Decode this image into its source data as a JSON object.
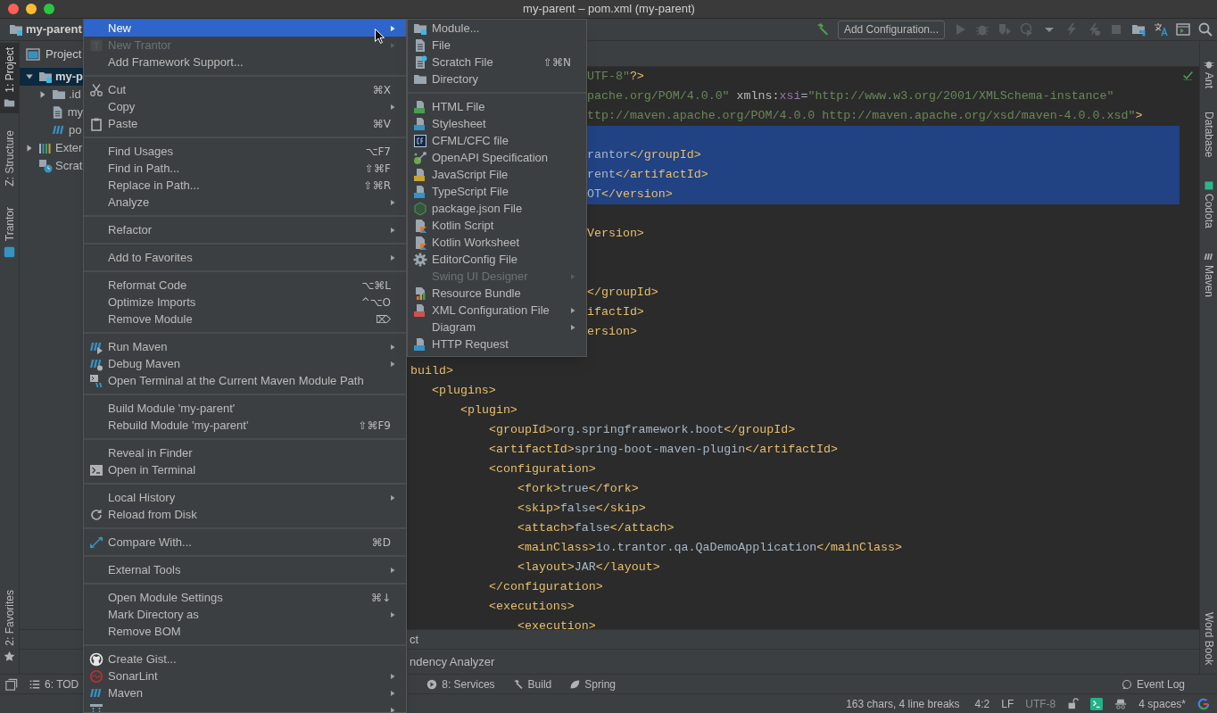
{
  "window": {
    "title": "my-parent – pom.xml (my-parent)"
  },
  "toolbar": {
    "breadcrumb": "my-parent",
    "run_config": "Add Configuration..."
  },
  "left_tool_tabs": [
    {
      "label": "1: Project",
      "selected": true
    },
    {
      "label": "Z: Structure",
      "selected": false
    },
    {
      "label": "Trantor",
      "selected": false
    },
    {
      "label": "2: Favorites",
      "selected": false
    }
  ],
  "project_panel": {
    "title": "Project",
    "tree": [
      {
        "label": "my-p",
        "selected": true,
        "expanded": true,
        "children": [
          {
            "label": ".id",
            "selected": false,
            "expanded": false
          },
          {
            "label": "my",
            "selected": false
          },
          {
            "label": "po",
            "selected": false
          }
        ]
      },
      {
        "label": "Exter",
        "selected": false,
        "expanded": false
      },
      {
        "label": "Scrat",
        "selected": false
      }
    ]
  },
  "editor": {
    "lines": [
      {
        "text": "UTF-8\"?>",
        "selected": false
      },
      {
        "text": "pache.org/POM/4.0.0\" xmlns:xsi=\"http://www.w3.org/2001/XMLSchema-instance\"",
        "selected": false
      },
      {
        "text": "ttp://maven.apache.org/POM/4.0.0 http://maven.apache.org/xsd/maven-4.0.0.xsd\">",
        "selected": false
      },
      {
        "kind": "blank",
        "selected": true
      },
      {
        "text": "rantor</groupId>",
        "selected": true
      },
      {
        "text": "rent</artifactId>",
        "selected": true
      },
      {
        "text": "OT</version>",
        "selected": true
      },
      {
        "kind": "blank"
      },
      {
        "text": "Version>",
        "selected": false
      },
      {
        "kind": "blank"
      },
      {
        "kind": "blank"
      },
      {
        "text": "</groupId>",
        "selected": false
      },
      {
        "text": "ifactId>",
        "selected": false
      },
      {
        "text": "ersion>",
        "selected": false
      },
      {
        "kind": "blank"
      }
    ],
    "tree": [
      {
        "text": "build>",
        "children": [
          {
            "text": "<plugins>",
            "children": [
              {
                "text": "<plugin>",
                "children": [
                  {
                    "text": "<groupId>org.springframework.boot</groupId>"
                  },
                  {
                    "text": "<artifactId>spring-boot-maven-plugin</artifactId>"
                  },
                  {
                    "text": "<configuration>",
                    "children": [
                      {
                        "text": "<fork>true</fork>"
                      },
                      {
                        "text": "<skip>false</skip>"
                      },
                      {
                        "text": "<attach>false</attach>"
                      },
                      {
                        "text": "<mainClass>io.trantor.qa.QaDemoApplication</mainClass>"
                      },
                      {
                        "text": "<layout>JAR</layout>"
                      }
                    ]
                  },
                  {
                    "text": "</configuration>"
                  },
                  {
                    "text": "<executions>",
                    "children": [
                      {
                        "text": "<execution>"
                      }
                    ]
                  }
                ]
              }
            ]
          }
        ]
      }
    ]
  },
  "bottom_panel": {
    "lines": [
      "ct",
      "ndency Analyzer"
    ]
  },
  "bottom_tool_tabs": [
    "6: TOD",
    "8: Services",
    "Build",
    "Spring"
  ],
  "event_log": "Event Log",
  "status_bar": {
    "info": "163 chars, 4 line breaks",
    "position": "4:2",
    "line_separator": "LF",
    "encoding": "UTF-8",
    "indent": "4 spaces*"
  },
  "right_tool_tabs": [
    "Ant",
    "Database",
    "Codota",
    "Maven",
    "Word Book"
  ],
  "context_menu": {
    "sections": [
      [
        {
          "label": "New",
          "submenu": true,
          "disabled": false,
          "selected": true
        },
        {
          "label": "New Trantor",
          "submenu": true,
          "disabled": true,
          "selected": false
        },
        {
          "label": "Add Framework Support...",
          "submenu": false,
          "disabled": false,
          "selected": false
        }
      ],
      [
        {
          "label": "Cut",
          "shortcut": "⌘X",
          "submenu": false,
          "disabled": false,
          "selected": false
        },
        {
          "label": "Copy",
          "submenu": true,
          "disabled": false,
          "selected": false
        },
        {
          "label": "Paste",
          "shortcut": "⌘V",
          "submenu": false,
          "disabled": false,
          "selected": false
        }
      ],
      [
        {
          "label": "Find Usages",
          "shortcut": "⌥F7",
          "submenu": false,
          "disabled": false,
          "selected": false
        },
        {
          "label": "Find in Path...",
          "shortcut": "⇧⌘F",
          "submenu": false,
          "disabled": false,
          "selected": false
        },
        {
          "label": "Replace in Path...",
          "shortcut": "⇧⌘R",
          "submenu": false,
          "disabled": false,
          "selected": false
        },
        {
          "label": "Analyze",
          "submenu": true,
          "disabled": false,
          "selected": false
        }
      ],
      [
        {
          "label": "Refactor",
          "submenu": true,
          "disabled": false,
          "selected": false
        }
      ],
      [
        {
          "label": "Add to Favorites",
          "submenu": true,
          "disabled": false,
          "selected": false
        }
      ],
      [
        {
          "label": "Reformat Code",
          "shortcut": "⌥⌘L",
          "submenu": false,
          "disabled": false,
          "selected": false
        },
        {
          "label": "Optimize Imports",
          "shortcut": "^⌥O",
          "submenu": false,
          "disabled": false,
          "selected": false
        },
        {
          "label": "Remove Module",
          "shortcut": "⌦",
          "submenu": false,
          "disabled": false,
          "selected": false
        }
      ],
      [
        {
          "label": "Run Maven",
          "submenu": true,
          "disabled": false,
          "selected": false
        },
        {
          "label": "Debug Maven",
          "submenu": true,
          "disabled": false,
          "selected": false
        },
        {
          "label": "Open Terminal at the Current Maven Module Path",
          "submenu": false,
          "disabled": false,
          "selected": false
        }
      ],
      [
        {
          "label": "Build Module 'my-parent'",
          "submenu": false,
          "disabled": false,
          "selected": false
        },
        {
          "label": "Rebuild Module 'my-parent'",
          "shortcut": "⇧⌘F9",
          "submenu": false,
          "disabled": false,
          "selected": false
        }
      ],
      [
        {
          "label": "Reveal in Finder",
          "submenu": false,
          "disabled": false,
          "selected": false
        },
        {
          "label": "Open in Terminal",
          "submenu": false,
          "disabled": false,
          "selected": false
        }
      ],
      [
        {
          "label": "Local History",
          "submenu": true,
          "disabled": false,
          "selected": false
        },
        {
          "label": "Reload from Disk",
          "submenu": false,
          "disabled": false,
          "selected": false
        }
      ],
      [
        {
          "label": "Compare With...",
          "shortcut": "⌘D",
          "submenu": false,
          "disabled": false,
          "selected": false
        }
      ],
      [
        {
          "label": "External Tools",
          "submenu": true,
          "disabled": false,
          "selected": false
        }
      ],
      [
        {
          "label": "Open Module Settings",
          "shortcut": "⌘↓",
          "submenu": false,
          "disabled": false,
          "selected": false
        },
        {
          "label": "Mark Directory as",
          "submenu": true,
          "disabled": false,
          "selected": false
        },
        {
          "label": "Remove BOM",
          "submenu": false,
          "disabled": false,
          "selected": false
        }
      ],
      [
        {
          "label": "Create Gist...",
          "submenu": false,
          "disabled": false,
          "selected": false
        },
        {
          "label": "SonarLint",
          "submenu": true,
          "disabled": false,
          "selected": false
        },
        {
          "label": "Maven",
          "submenu": true,
          "disabled": false,
          "selected": false
        },
        {
          "submenu": true,
          "disabled": false,
          "selected": false
        }
      ]
    ]
  },
  "new_submenu": {
    "sections": [
      [
        {
          "label": "Module...",
          "submenu": false,
          "disabled": false,
          "selected": false
        },
        {
          "label": "File",
          "submenu": false,
          "disabled": false,
          "selected": false
        },
        {
          "label": "Scratch File",
          "shortcut": "⇧⌘N",
          "submenu": false,
          "disabled": false,
          "selected": false
        },
        {
          "label": "Directory",
          "submenu": false,
          "disabled": false,
          "selected": false
        }
      ],
      [
        {
          "label": "HTML File",
          "submenu": false,
          "disabled": false,
          "selected": false
        },
        {
          "label": "Stylesheet",
          "submenu": false,
          "disabled": false,
          "selected": false
        },
        {
          "label": "CFML/CFC file",
          "submenu": false,
          "disabled": false,
          "selected": false
        },
        {
          "label": "OpenAPI Specification",
          "submenu": false,
          "disabled": false,
          "selected": false
        },
        {
          "label": "JavaScript File",
          "submenu": false,
          "disabled": false,
          "selected": false
        },
        {
          "label": "TypeScript File",
          "submenu": false,
          "disabled": false,
          "selected": false
        },
        {
          "label": "package.json File",
          "submenu": false,
          "disabled": false,
          "selected": false
        },
        {
          "label": "Kotlin Script",
          "submenu": false,
          "disabled": false,
          "selected": false
        },
        {
          "label": "Kotlin Worksheet",
          "submenu": false,
          "disabled": false,
          "selected": false
        },
        {
          "label": "EditorConfig File",
          "submenu": false,
          "disabled": false,
          "selected": false
        },
        {
          "label": "Swing UI Designer",
          "submenu": true,
          "disabled": true,
          "selected": false
        },
        {
          "label": "Resource Bundle",
          "submenu": false,
          "disabled": false,
          "selected": false
        },
        {
          "label": "XML Configuration File",
          "submenu": true,
          "disabled": false,
          "selected": false
        },
        {
          "label": "Diagram",
          "submenu": true,
          "disabled": false,
          "selected": false
        },
        {
          "label": "HTTP Request",
          "submenu": false,
          "disabled": false,
          "selected": false
        }
      ]
    ]
  }
}
